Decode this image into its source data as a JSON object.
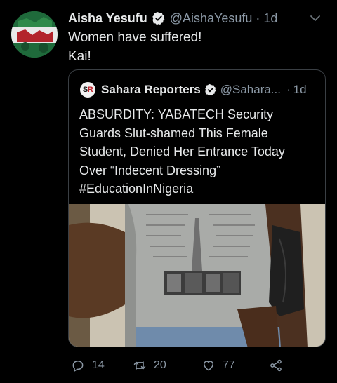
{
  "tweet": {
    "author_name": "Aisha Yesufu",
    "author_handle": "@AishaYesufu",
    "separator": "·",
    "time": "1d",
    "text_lines": [
      "Women have suffered!",
      "Kai!"
    ]
  },
  "quoted_tweet": {
    "avatar_text_left": "S",
    "avatar_text_right": "R",
    "author_name": "Sahara Reporters",
    "author_handle": "@Sahara...",
    "separator": "·",
    "time": "1d",
    "text_lines": [
      "ABSURDITY: YABATECH Security",
      "Guards Slut-shamed This Female",
      "Student, Denied Her Entrance Today",
      "Over “Indecent Dressing”",
      "#EducationInNigeria"
    ]
  },
  "actions": {
    "reply_count": "14",
    "retweet_count": "20",
    "like_count": "77"
  },
  "icons": {
    "verified": "verified-badge-icon",
    "caret": "chevron-down-icon",
    "reply": "reply-icon",
    "retweet": "retweet-icon",
    "like": "heart-icon",
    "share": "share-icon"
  },
  "colors": {
    "background": "#000000",
    "text": "#e7e9ea",
    "muted": "#8b98a5",
    "border": "#3a3f44"
  }
}
